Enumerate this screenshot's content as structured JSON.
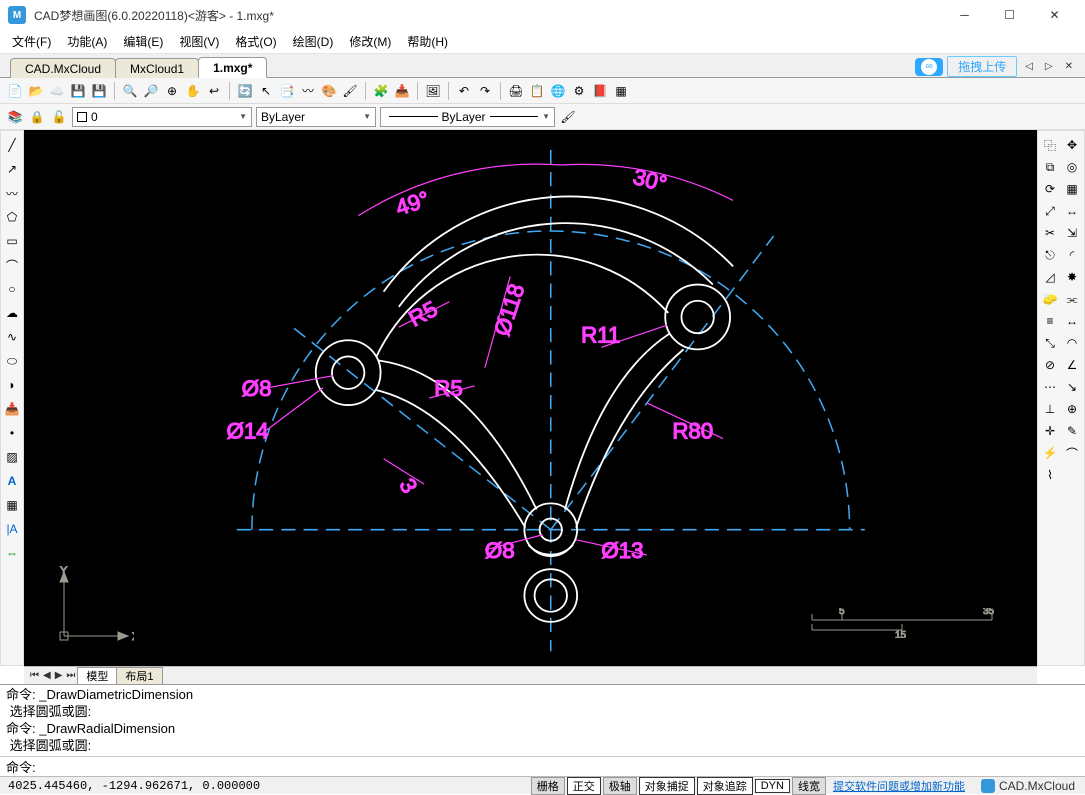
{
  "app": {
    "title": "CAD梦想画图(6.0.20220118)<游客> - 1.mxg*",
    "logo": "M"
  },
  "menu": [
    "文件(F)",
    "功能(A)",
    "编辑(E)",
    "视图(V)",
    "格式(O)",
    "绘图(D)",
    "修改(M)",
    "帮助(H)"
  ],
  "tabs": {
    "items": [
      "CAD.MxCloud",
      "MxCloud1",
      "1.mxg*"
    ],
    "active": 2,
    "drag_label": "拖拽上传"
  },
  "layer": {
    "name": "0",
    "color_label": "ByLayer",
    "linetype_label": "ByLayer"
  },
  "viewport": {
    "labels": {
      "angle49": "49°",
      "angle30": "30°",
      "R5a": "R5",
      "R5b": "R5",
      "R11": "R11",
      "R80": "R80",
      "d118": "Ø118",
      "d8a": "Ø8",
      "d14": "Ø14",
      "d8b": "Ø8",
      "d13": "Ø13",
      "dim3": "3"
    },
    "axis_labels": {
      "x": "X",
      "y": "Y"
    },
    "ruler": {
      "t1": "5",
      "t2": "35",
      "t3": "15"
    }
  },
  "bottomtabs": {
    "items": [
      "模型",
      "布局1"
    ],
    "active": 0
  },
  "command": {
    "lines": [
      "命令: _DrawDiametricDimension",
      " 选择圆弧或圆:",
      "命令: _DrawRadialDimension",
      " 选择圆弧或圆:"
    ],
    "prompt": "命令:"
  },
  "status": {
    "coords": "4025.445460, -1294.962671, 0.000000",
    "buttons": [
      {
        "label": "栅格",
        "on": false
      },
      {
        "label": "正交",
        "on": true
      },
      {
        "label": "极轴",
        "on": false
      },
      {
        "label": "对象捕捉",
        "on": true
      },
      {
        "label": "对象追踪",
        "on": true
      },
      {
        "label": "DYN",
        "on": true
      },
      {
        "label": "线宽",
        "on": false
      }
    ],
    "link": "提交软件问题或增加新功能",
    "brand": "CAD.MxCloud"
  }
}
